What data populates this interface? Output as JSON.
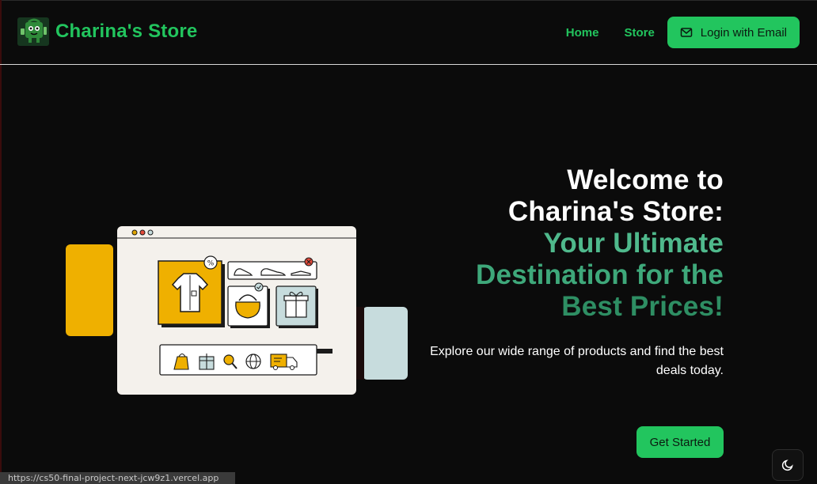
{
  "brand": {
    "name": "Charina's Store",
    "logo_icon": "store-mascot-icon"
  },
  "nav": {
    "home_label": "Home",
    "store_label": "Store",
    "login_label": "Login with Email",
    "login_icon": "mail-icon"
  },
  "hero": {
    "title_white_1": "Welcome to",
    "title_white_2": "Charina's Store:",
    "title_green_1": "Your Ultimate",
    "title_green_2": "Destination for the",
    "title_green_3": "Best Prices!",
    "subtitle": "Explore our wide range of products and find the best deals today.",
    "cta_label": "Get Started"
  },
  "illustration": {
    "icon": "online-shopping-illustration",
    "badge_percent": "%"
  },
  "theme_toggle": {
    "icon": "moon-icon"
  },
  "status_bar": {
    "url": "https://cs50-final-project-next-jcw9z1.vercel.app"
  },
  "colors": {
    "accent": "#22c55e",
    "background": "#0b0b0b",
    "title_green": "#3ea87a",
    "illus_yellow": "#efb000",
    "illus_blue": "#c7dcdd"
  }
}
